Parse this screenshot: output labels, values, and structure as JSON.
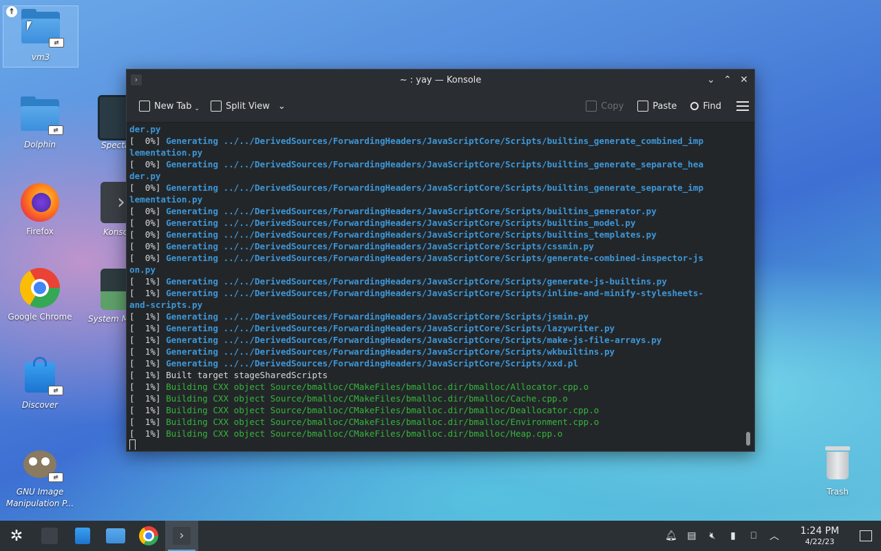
{
  "desktop": {
    "icons": [
      {
        "label": "vm3"
      },
      {
        "label": "Dolphin"
      },
      {
        "label": "Firefox"
      },
      {
        "label": "Google Chrome"
      },
      {
        "label": "Discover"
      },
      {
        "label": "GNU Image Manipulation P..."
      },
      {
        "label": "Trash"
      }
    ],
    "partial_icons": [
      {
        "label": "Specta"
      },
      {
        "label": "Konso"
      },
      {
        "label": "System M"
      }
    ],
    "link_badge": "⇄"
  },
  "konsole": {
    "title": "~ : yay — Konsole",
    "toolbar": {
      "new_tab": "New Tab",
      "split_view": "Split View",
      "copy": "Copy",
      "paste": "Paste",
      "find": "Find"
    },
    "lines": [
      {
        "prefix": "",
        "text": "der.py",
        "style": "gen"
      },
      {
        "prefix": "[  0%] ",
        "text": "Generating ../../DerivedSources/ForwardingHeaders/JavaScriptCore/Scripts/builtins_generate_combined_imp",
        "style": "gen"
      },
      {
        "prefix": "",
        "text": "lementation.py",
        "style": "gen"
      },
      {
        "prefix": "[  0%] ",
        "text": "Generating ../../DerivedSources/ForwardingHeaders/JavaScriptCore/Scripts/builtins_generate_separate_hea",
        "style": "gen"
      },
      {
        "prefix": "",
        "text": "der.py",
        "style": "gen"
      },
      {
        "prefix": "[  0%] ",
        "text": "Generating ../../DerivedSources/ForwardingHeaders/JavaScriptCore/Scripts/builtins_generate_separate_imp",
        "style": "gen"
      },
      {
        "prefix": "",
        "text": "lementation.py",
        "style": "gen"
      },
      {
        "prefix": "[  0%] ",
        "text": "Generating ../../DerivedSources/ForwardingHeaders/JavaScriptCore/Scripts/builtins_generator.py",
        "style": "gen"
      },
      {
        "prefix": "[  0%] ",
        "text": "Generating ../../DerivedSources/ForwardingHeaders/JavaScriptCore/Scripts/builtins_model.py",
        "style": "gen"
      },
      {
        "prefix": "[  0%] ",
        "text": "Generating ../../DerivedSources/ForwardingHeaders/JavaScriptCore/Scripts/builtins_templates.py",
        "style": "gen"
      },
      {
        "prefix": "[  0%] ",
        "text": "Generating ../../DerivedSources/ForwardingHeaders/JavaScriptCore/Scripts/cssmin.py",
        "style": "gen"
      },
      {
        "prefix": "[  0%] ",
        "text": "Generating ../../DerivedSources/ForwardingHeaders/JavaScriptCore/Scripts/generate-combined-inspector-js",
        "style": "gen"
      },
      {
        "prefix": "",
        "text": "on.py",
        "style": "gen"
      },
      {
        "prefix": "[  1%] ",
        "text": "Generating ../../DerivedSources/ForwardingHeaders/JavaScriptCore/Scripts/generate-js-builtins.py",
        "style": "gen"
      },
      {
        "prefix": "[  1%] ",
        "text": "Generating ../../DerivedSources/ForwardingHeaders/JavaScriptCore/Scripts/inline-and-minify-stylesheets-",
        "style": "gen"
      },
      {
        "prefix": "",
        "text": "and-scripts.py",
        "style": "gen"
      },
      {
        "prefix": "[  1%] ",
        "text": "Generating ../../DerivedSources/ForwardingHeaders/JavaScriptCore/Scripts/jsmin.py",
        "style": "gen"
      },
      {
        "prefix": "[  1%] ",
        "text": "Generating ../../DerivedSources/ForwardingHeaders/JavaScriptCore/Scripts/lazywriter.py",
        "style": "gen"
      },
      {
        "prefix": "[  1%] ",
        "text": "Generating ../../DerivedSources/ForwardingHeaders/JavaScriptCore/Scripts/make-js-file-arrays.py",
        "style": "gen"
      },
      {
        "prefix": "[  1%] ",
        "text": "Generating ../../DerivedSources/ForwardingHeaders/JavaScriptCore/Scripts/wkbuiltins.py",
        "style": "gen"
      },
      {
        "prefix": "[  1%] ",
        "text": "Generating ../../DerivedSources/ForwardingHeaders/JavaScriptCore/Scripts/xxd.pl",
        "style": "gen"
      },
      {
        "prefix": "[  1%] ",
        "text": "Built target stageSharedScripts",
        "style": "plain"
      },
      {
        "prefix": "[  1%] ",
        "text": "Building CXX object Source/bmalloc/CMakeFiles/bmalloc.dir/bmalloc/Allocator.cpp.o",
        "style": "build"
      },
      {
        "prefix": "[  1%] ",
        "text": "Building CXX object Source/bmalloc/CMakeFiles/bmalloc.dir/bmalloc/Cache.cpp.o",
        "style": "build"
      },
      {
        "prefix": "[  1%] ",
        "text": "Building CXX object Source/bmalloc/CMakeFiles/bmalloc.dir/bmalloc/Deallocator.cpp.o",
        "style": "build"
      },
      {
        "prefix": "[  1%] ",
        "text": "Building CXX object Source/bmalloc/CMakeFiles/bmalloc.dir/bmalloc/Environment.cpp.o",
        "style": "build"
      },
      {
        "prefix": "[  1%] ",
        "text": "Building CXX object Source/bmalloc/CMakeFiles/bmalloc.dir/bmalloc/Heap.cpp.o",
        "style": "build"
      }
    ]
  },
  "taskbar": {
    "clock_time": "1:24 PM",
    "clock_date": "4/22/23",
    "tray_icons": [
      "bell-icon",
      "clipboard-icon",
      "volume-muted-icon",
      "usb-icon",
      "input-method-icon",
      "chevron-up-icon"
    ]
  },
  "colors": {
    "generating": "#3d97d8",
    "building": "#35b53a",
    "accent": "#3daee9"
  }
}
